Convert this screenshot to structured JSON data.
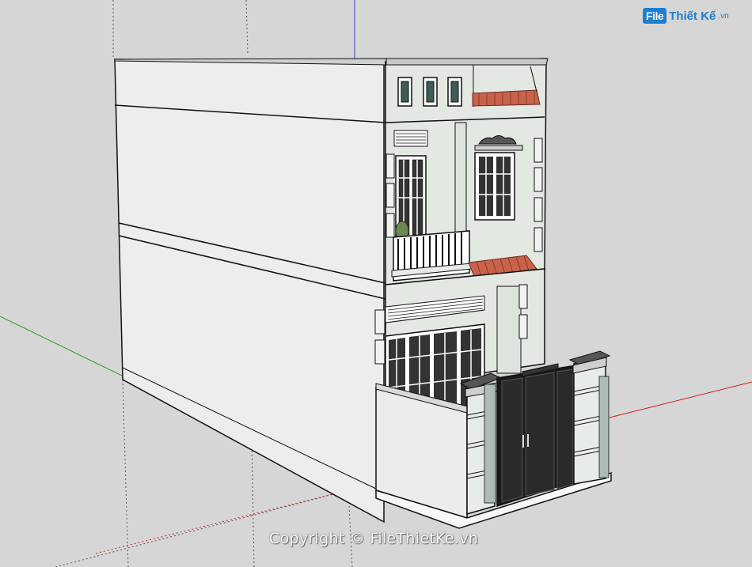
{
  "logo": {
    "badge": "File",
    "name": "Thiết Kế",
    "suffix": ".vn"
  },
  "watermark": {
    "text": "Copyright © FileThietKe.vn"
  },
  "colors": {
    "background": "#d6d6d6",
    "wall": "#ededed",
    "facade": "#e3e8e3",
    "roof_tile": "#c9624a",
    "gate": "#1a1a1a",
    "axis_red": "#d02020",
    "axis_green": "#2a9a2a",
    "axis_blue": "#3344cc"
  }
}
